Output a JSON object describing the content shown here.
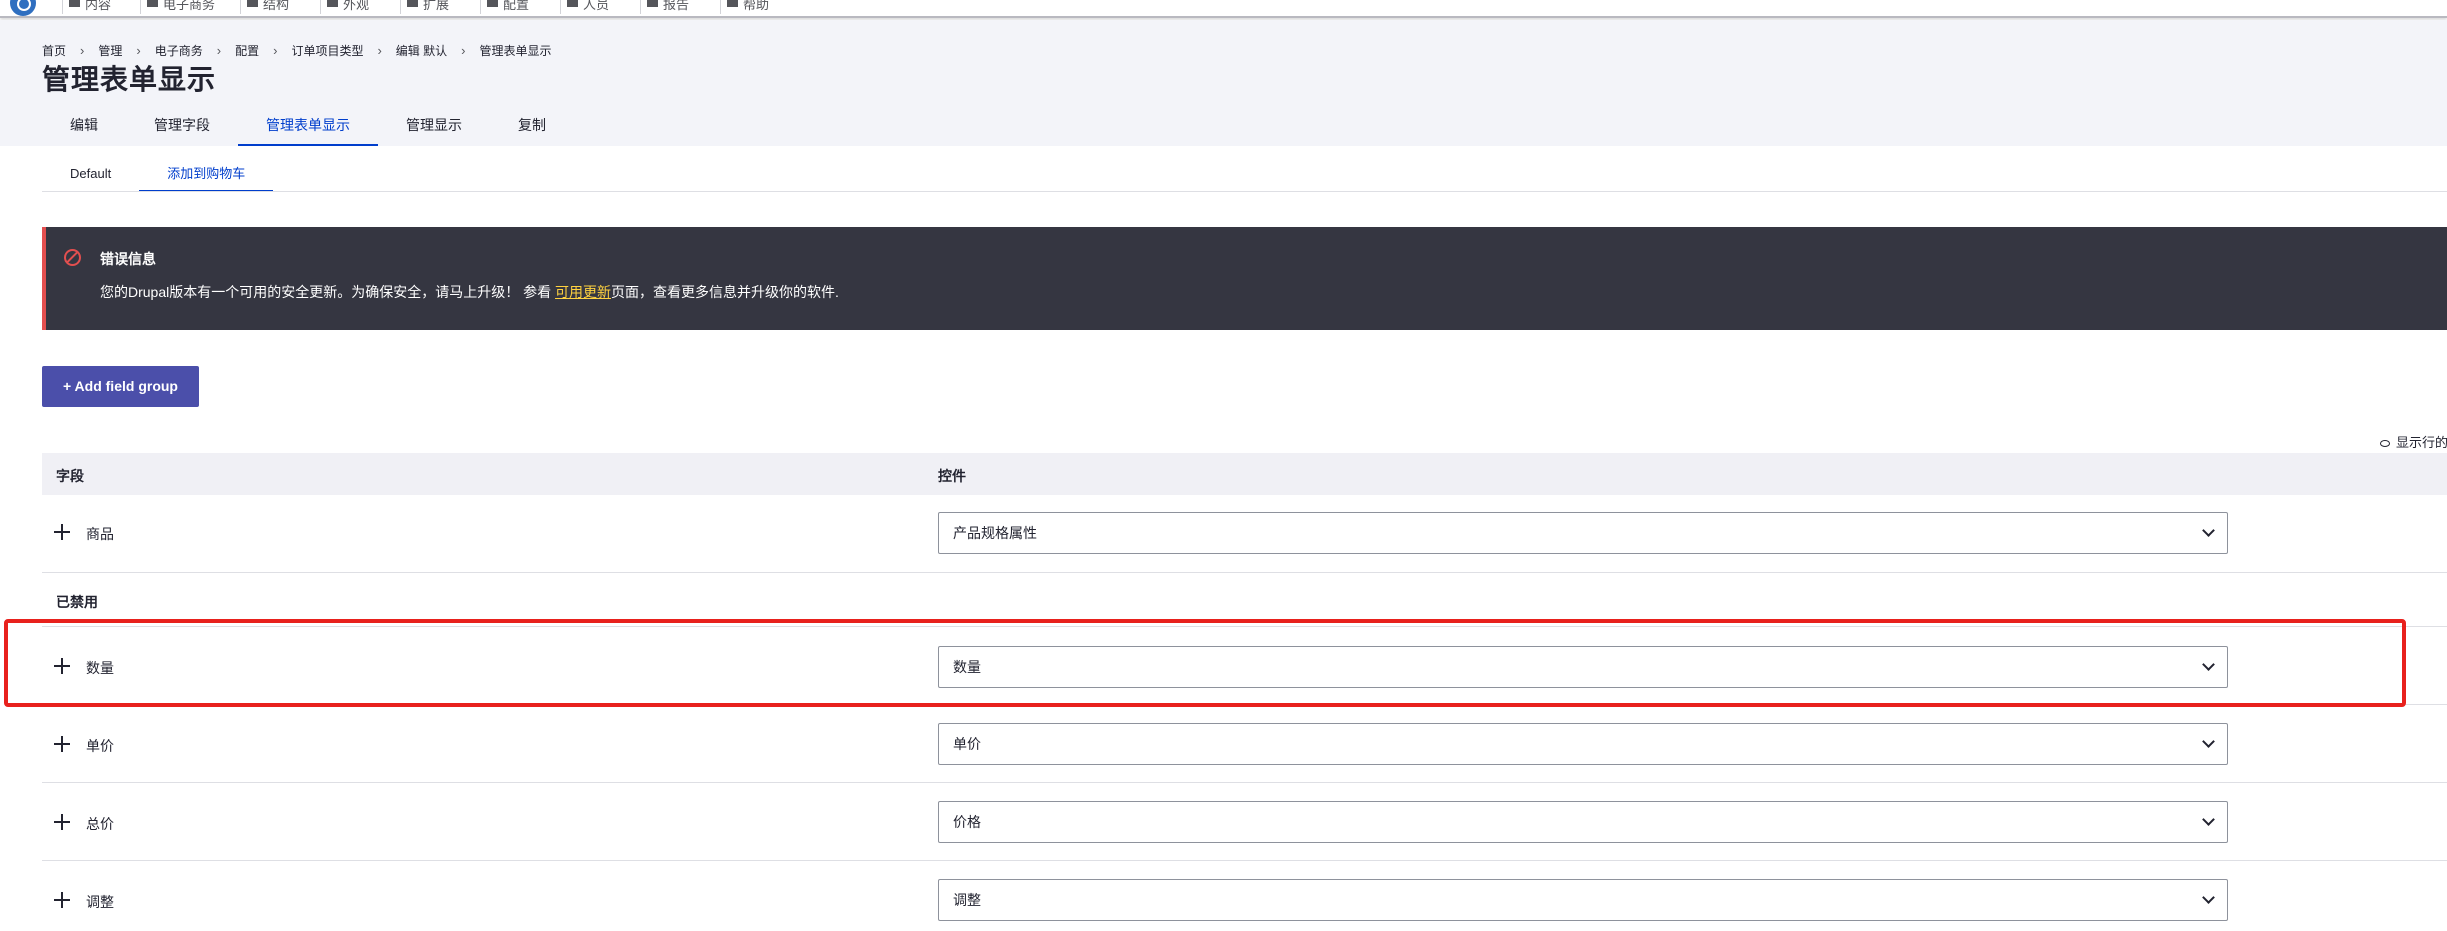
{
  "toolbar": {
    "items": [
      "内容",
      "电子商务",
      "结构",
      "外观",
      "扩展",
      "配置",
      "人员",
      "报告",
      "帮助"
    ]
  },
  "breadcrumb": [
    "首页",
    "管理",
    "电子商务",
    "配置",
    "订单项目类型",
    "编辑 默认",
    "管理表单显示"
  ],
  "page_title": "管理表单显示",
  "primary_tabs": [
    "编辑",
    "管理字段",
    "管理表单显示",
    "管理显示",
    "复制"
  ],
  "secondary_tabs": [
    "Default",
    "添加到购物车"
  ],
  "message": {
    "title": "错误信息",
    "text_before": "您的Drupal版本有一个可用的安全更新。为确保安全，请马上升级！ 参看 ",
    "link": "可用更新",
    "text_after": "页面，查看更多信息并升级你的软件."
  },
  "add_group_button": "+ Add field group",
  "show_weights": "显示行的",
  "table": {
    "col_field": "字段",
    "col_widget": "控件",
    "rows": [
      {
        "field": "商品",
        "widget": "产品规格属性"
      }
    ],
    "disabled_label": "已禁用",
    "disabled_rows": [
      {
        "field": "数量",
        "widget": "数量"
      },
      {
        "field": "单价",
        "widget": "单价"
      },
      {
        "field": "总价",
        "widget": "价格"
      },
      {
        "field": "调整",
        "widget": "调整"
      }
    ]
  },
  "colors": {
    "accent": "#003ecc",
    "button": "#4b4faa",
    "message_bg": "#353641",
    "error": "#e34f4f",
    "highlight": "#e8211d"
  }
}
